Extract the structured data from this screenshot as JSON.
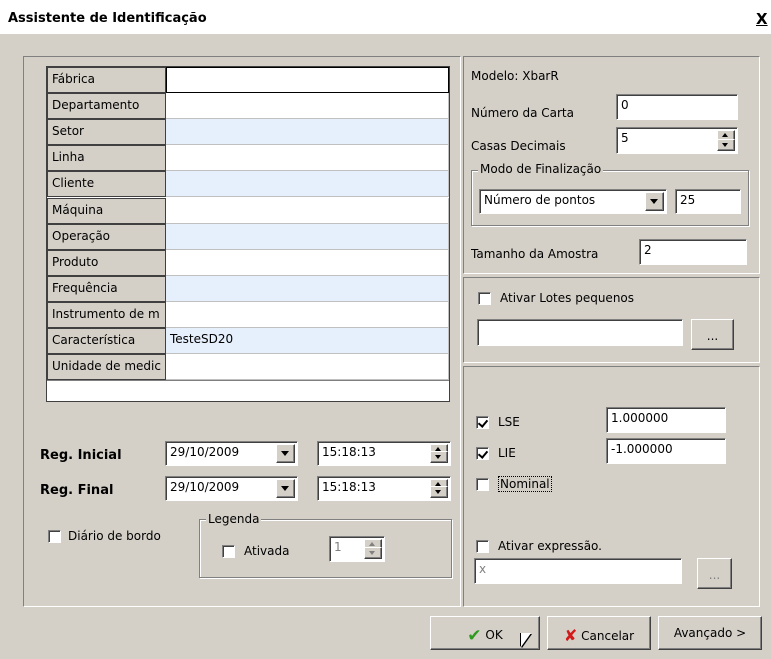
{
  "window": {
    "title": "Assistente de Identificação",
    "close_label": "X"
  },
  "grid": {
    "rows": [
      {
        "label": "Fábrica",
        "value": ""
      },
      {
        "label": "Departamento",
        "value": ""
      },
      {
        "label": "Setor",
        "value": ""
      },
      {
        "label": "Linha",
        "value": ""
      },
      {
        "label": "Cliente",
        "value": ""
      },
      {
        "label": "Máquina",
        "value": ""
      },
      {
        "label": "Operação",
        "value": ""
      },
      {
        "label": "Produto",
        "value": ""
      },
      {
        "label": "Frequência",
        "value": ""
      },
      {
        "label": "Instrumento de m",
        "value": ""
      },
      {
        "label": "Característica",
        "value": "TesteSD20"
      },
      {
        "label": "Unidade de medic",
        "value": ""
      }
    ]
  },
  "registro": {
    "inicial_label": "Reg. Inicial",
    "inicial_date": "29/10/2009",
    "inicial_time": "15:18:13",
    "final_label": "Reg. Final",
    "final_date": "29/10/2009",
    "final_time": "15:18:13"
  },
  "diario": {
    "label": "Diário de bordo",
    "checked": false
  },
  "legenda": {
    "title": "Legenda",
    "ativada_label": "Ativada",
    "ativada_checked": false,
    "value": "1"
  },
  "modelo": {
    "label": "Modelo: XbarR",
    "numero_carta_label": "Número da Carta",
    "numero_carta_value": "0",
    "casas_decimais_label": "Casas Decimais",
    "casas_decimais_value": "5"
  },
  "finalizacao": {
    "title": "Modo de Finalização",
    "mode_value": "Número de pontos",
    "count_value": "25"
  },
  "amostra": {
    "label": "Tamanho da Amostra",
    "value": "2"
  },
  "lotes": {
    "label": "Ativar Lotes pequenos",
    "checked": false,
    "value": "",
    "browse_label": "..."
  },
  "limites": {
    "lse_label": "LSE",
    "lse_checked": true,
    "lse_value": "1.000000",
    "lie_label": "LIE",
    "lie_checked": true,
    "lie_value": "-1.000000",
    "nominal_label": "Nominal",
    "nominal_checked": false
  },
  "expressao": {
    "label": "Ativar expressão.",
    "checked": false,
    "value": "x",
    "browse_label": "..."
  },
  "buttons": {
    "ok_label": "OK",
    "cancel_label": "Cancelar",
    "advanced_label": "Avançado >"
  },
  "colors": {
    "row_alt": "#e6effc",
    "ok_green": "#2e9a1e",
    "cancel_red": "#d21a1a",
    "face": "#d4d0c8"
  }
}
